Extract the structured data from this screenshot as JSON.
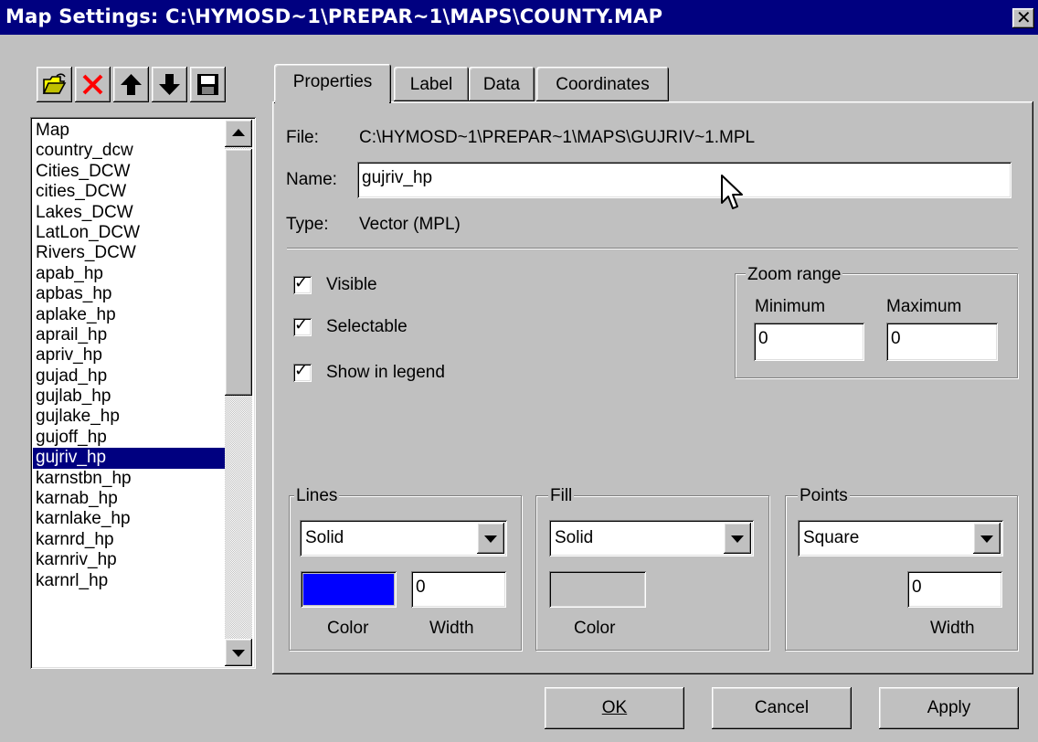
{
  "window": {
    "title": "Map Settings: C:\\HYMOSD~1\\PREPAR~1\\MAPS\\COUNTY.MAP",
    "close_glyph": "x"
  },
  "toolbar": {
    "buttons": [
      "open-folder-icon",
      "delete-icon",
      "move-up-icon",
      "move-down-icon",
      "save-icon"
    ]
  },
  "layers": {
    "items": [
      "Map",
      "country_dcw",
      "Cities_DCW",
      "cities_DCW",
      "Lakes_DCW",
      "LatLon_DCW",
      "Rivers_DCW",
      "apab_hp",
      "apbas_hp",
      "aplake_hp",
      "aprail_hp",
      "apriv_hp",
      "gujad_hp",
      "gujlab_hp",
      "gujlake_hp",
      "gujoff_hp",
      "gujriv_hp",
      "karnstbn_hp",
      "karnab_hp",
      "karnlake_hp",
      "karnrd_hp",
      "karnriv_hp",
      "karnrl_hp"
    ],
    "selected": "gujriv_hp"
  },
  "tabs": [
    "Properties",
    "Label",
    "Data",
    "Coordinates"
  ],
  "active_tab": "Properties",
  "properties": {
    "file_label": "File:",
    "file_value": "C:\\HYMOSD~1\\PREPAR~1\\MAPS\\GUJRIV~1.MPL",
    "name_label": "Name:",
    "name_value": "gujriv_hp",
    "type_label": "Type:",
    "type_value": "Vector (MPL)",
    "visible_label": "Visible",
    "visible_checked": true,
    "selectable_label": "Selectable",
    "selectable_checked": true,
    "legend_label": "Show in legend",
    "legend_checked": true,
    "zoom": {
      "title": "Zoom range",
      "min_label": "Minimum",
      "max_label": "Maximum",
      "min_value": "0",
      "max_value": "0"
    },
    "lines": {
      "title": "Lines",
      "style": "Solid",
      "color": "#0000ff",
      "color_label": "Color",
      "width_value": "0",
      "width_label": "Width"
    },
    "fill": {
      "title": "Fill",
      "style": "Solid",
      "color": "#c0c0c0",
      "color_label": "Color"
    },
    "points": {
      "title": "Points",
      "style": "Square",
      "width_value": "0",
      "width_label": "Width"
    }
  },
  "buttons": {
    "ok_label": "OK",
    "cancel_label": "Cancel",
    "apply_label": "Apply"
  }
}
